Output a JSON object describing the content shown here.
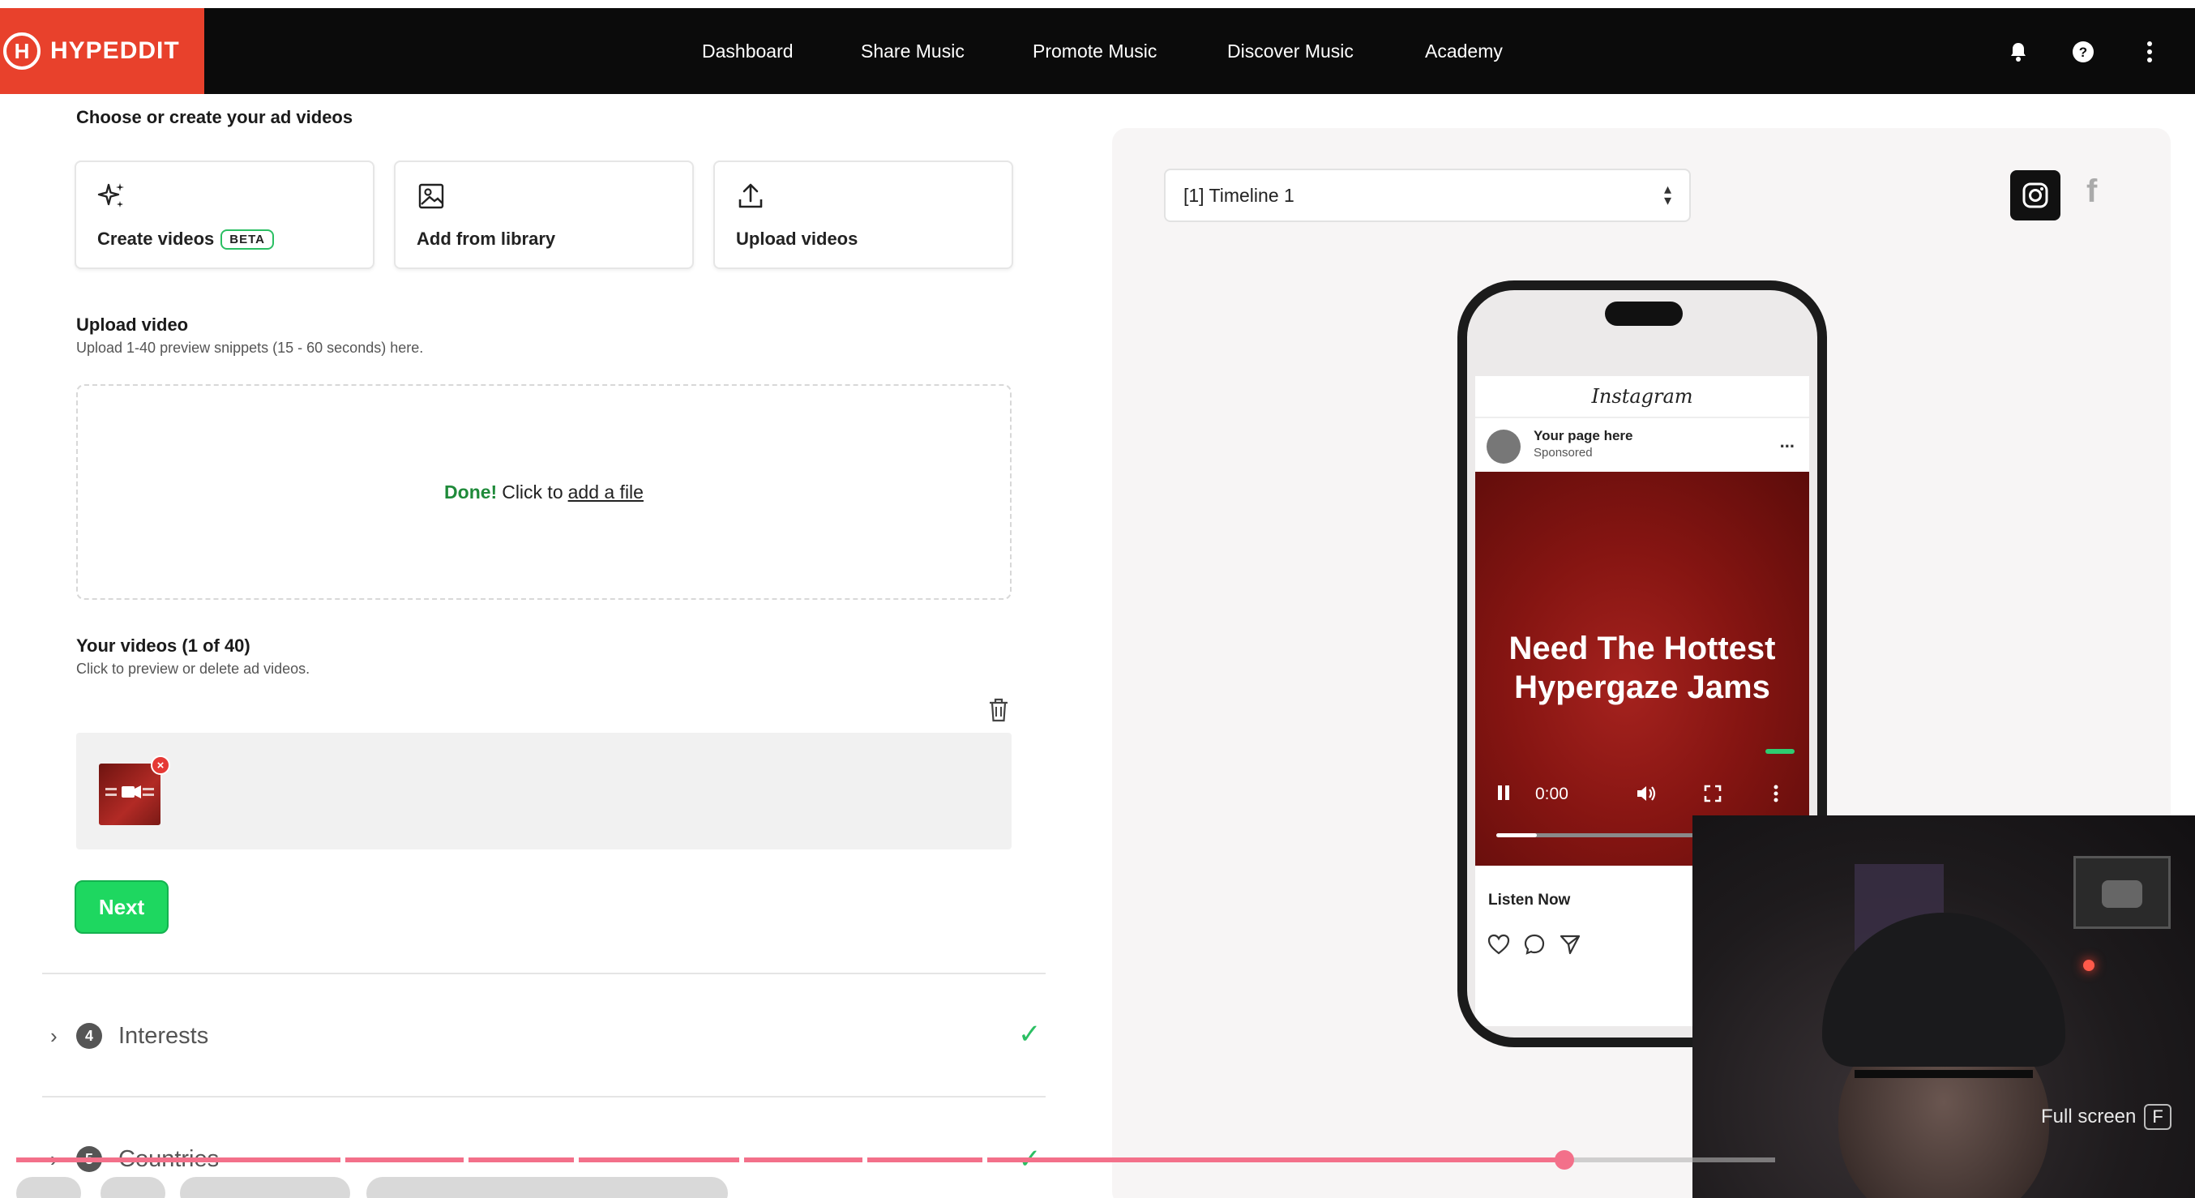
{
  "brand": {
    "name": "HYPEDDIT",
    "mark": "H",
    "color": "#e8412c"
  },
  "nav": {
    "items": [
      {
        "label": "Dashboard"
      },
      {
        "label": "Share Music"
      },
      {
        "label": "Promote Music"
      },
      {
        "label": "Discover Music"
      },
      {
        "label": "Academy"
      }
    ],
    "icons": [
      "bell-icon",
      "help-icon",
      "more-vert-icon"
    ]
  },
  "videos_section": {
    "title": "Choose or create your ad videos",
    "cards": [
      {
        "label": "Create videos",
        "badge": "BETA",
        "icon": "sparkles-icon"
      },
      {
        "label": "Add from library",
        "icon": "image-icon"
      },
      {
        "label": "Upload videos",
        "icon": "upload-icon"
      }
    ]
  },
  "upload": {
    "title": "Upload video",
    "subtitle": "Upload 1-40 preview snippets (15 - 60 seconds) here.",
    "status": "Done!",
    "prompt": "Click to",
    "link": "add a file"
  },
  "your_videos": {
    "title": "Your videos (1 of 40)",
    "subtitle": "Click to preview or delete ad videos."
  },
  "next_label": "Next",
  "steps": [
    {
      "number": "4",
      "label": "Interests",
      "complete": true
    },
    {
      "number": "5",
      "label": "Countries",
      "complete": true
    }
  ],
  "preview": {
    "timeline_select": "[1] Timeline 1",
    "platforms": [
      "instagram-icon",
      "facebook-icon"
    ],
    "post": {
      "app": "Instagram",
      "page_name": "Your page here",
      "sponsored": "Sponsored",
      "menu": "...",
      "ad_text_line1": "Need The Hottest",
      "ad_text_line2": "Hypergaze Jams",
      "time": "0:00",
      "playback_fraction": 0.14,
      "cta": "Listen Now"
    }
  },
  "video_player": {
    "fullscreen_label": "Full screen",
    "fullscreen_key": "F",
    "progress_fraction": 0.88
  },
  "colors": {
    "accent_green": "#1ed760",
    "check_green": "#2bbf63",
    "progress_pink": "#f3708a"
  }
}
